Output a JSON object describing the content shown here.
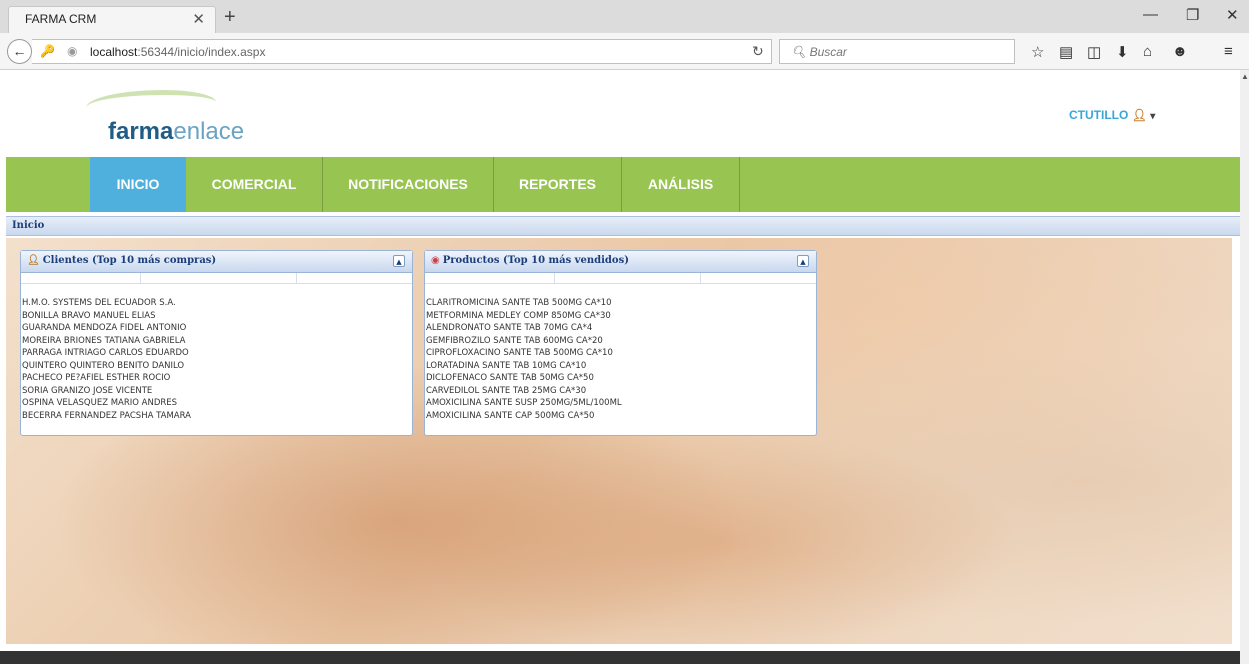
{
  "browser": {
    "tab_title": "FARMA CRM",
    "url_host": "localhost",
    "url_rest": ":56344/inicio/index.aspx",
    "search_placeholder": "Buscar"
  },
  "header": {
    "logo_bold": "farma",
    "logo_light": "enlace",
    "user_name": "CTUTILLO"
  },
  "menu": {
    "items": [
      {
        "label": "INICIO"
      },
      {
        "label": "COMERCIAL"
      },
      {
        "label": "NOTIFICACIONES"
      },
      {
        "label": "REPORTES"
      },
      {
        "label": "ANÁLISIS"
      }
    ]
  },
  "breadcrumb": "Inicio",
  "panels": {
    "clientes": {
      "title": "Clientes (Top 10 más compras)",
      "rows": [
        "H.M.O. SYSTEMS DEL ECUADOR S.A.",
        "BONILLA BRAVO MANUEL ELIAS",
        "GUARANDA MENDOZA FIDEL ANTONIO",
        "MOREIRA BRIONES TATIANA GABRIELA",
        "PARRAGA INTRIAGO CARLOS EDUARDO",
        "QUINTERO QUINTERO BENITO DANILO",
        "PACHECO PE?AFIEL ESTHER ROCIO",
        "SORIA GRANIZO JOSE VICENTE",
        "OSPINA VELASQUEZ MARIO ANDRES",
        "BECERRA FERNANDEZ PACSHA TAMARA"
      ]
    },
    "productos": {
      "title": "Productos (Top 10 más vendidos)",
      "rows": [
        "CLARITROMICINA SANTE TAB 500MG CA*10",
        "METFORMINA MEDLEY COMP 850MG CA*30",
        "ALENDRONATO SANTE TAB 70MG CA*4",
        "GEMFIBROZILO SANTE TAB 600MG CA*20",
        "CIPROFLOXACINO SANTE TAB 500MG CA*10",
        "LORATADINA SANTE TAB 10MG CA*10",
        "DICLOFENACO SANTE TAB 50MG CA*50",
        "CARVEDILOL SANTE TAB 25MG CA*30",
        "AMOXICILINA SANTE SUSP 250MG/5ML/100ML",
        "AMOXICILINA SANTE CAP 500MG CA*50"
      ]
    }
  }
}
